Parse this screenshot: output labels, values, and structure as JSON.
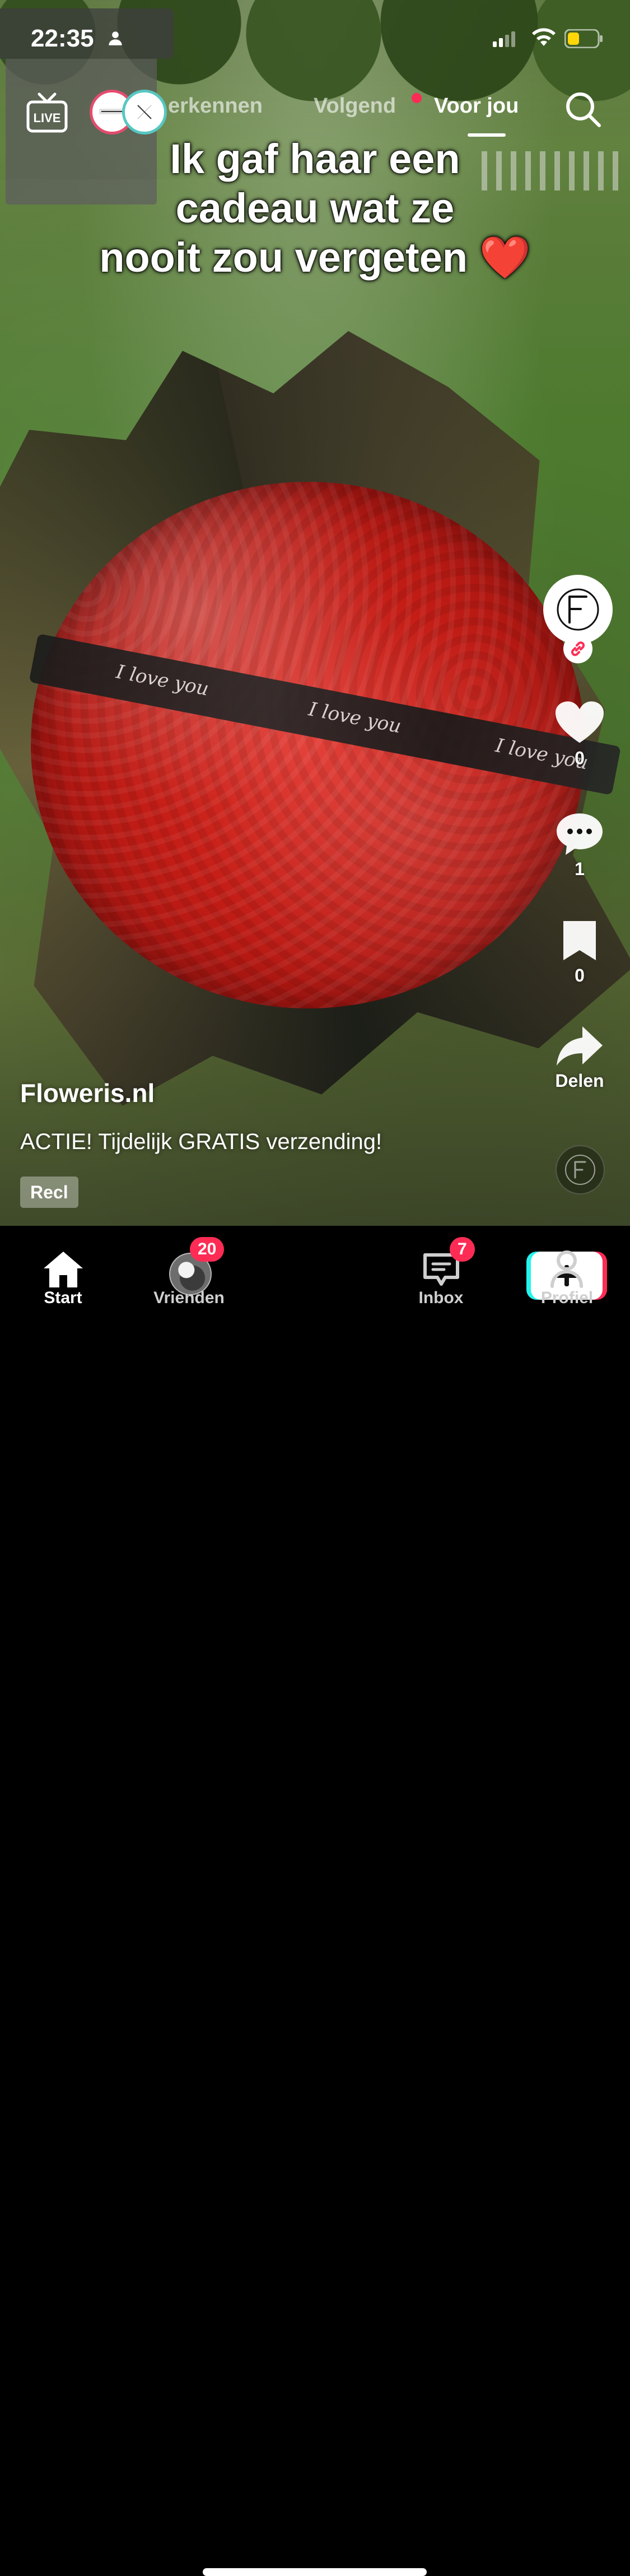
{
  "status_bar": {
    "time": "22:35"
  },
  "top_nav": {
    "live_label": "LIVE",
    "tabs": [
      {
        "label": "erkennen"
      },
      {
        "label": "Volgend"
      },
      {
        "label": "Voor jou"
      }
    ]
  },
  "video": {
    "caption_lines": [
      "Ik gaf haar een",
      "cadeau wat ze",
      "nooit zou vergeten ❤️"
    ],
    "ribbon_texts": [
      "I love you",
      "I love you",
      "I love you"
    ]
  },
  "actions": {
    "likes": "0",
    "comments": "1",
    "saves": "0",
    "share_label": "Delen"
  },
  "post": {
    "account": "Floweris.nl",
    "text": "ACTIE! Tijdelijk GRATIS verzending!",
    "ad_badge": "Recl"
  },
  "tab_bar": {
    "items": [
      {
        "label": "Start"
      },
      {
        "label": "Vrienden",
        "badge": "20"
      },
      {
        "label": ""
      },
      {
        "label": "Inbox",
        "badge": "7"
      },
      {
        "label": "Profiel"
      }
    ]
  },
  "colors": {
    "accent_red": "#fe2c55",
    "accent_cyan": "#25f4ee"
  }
}
